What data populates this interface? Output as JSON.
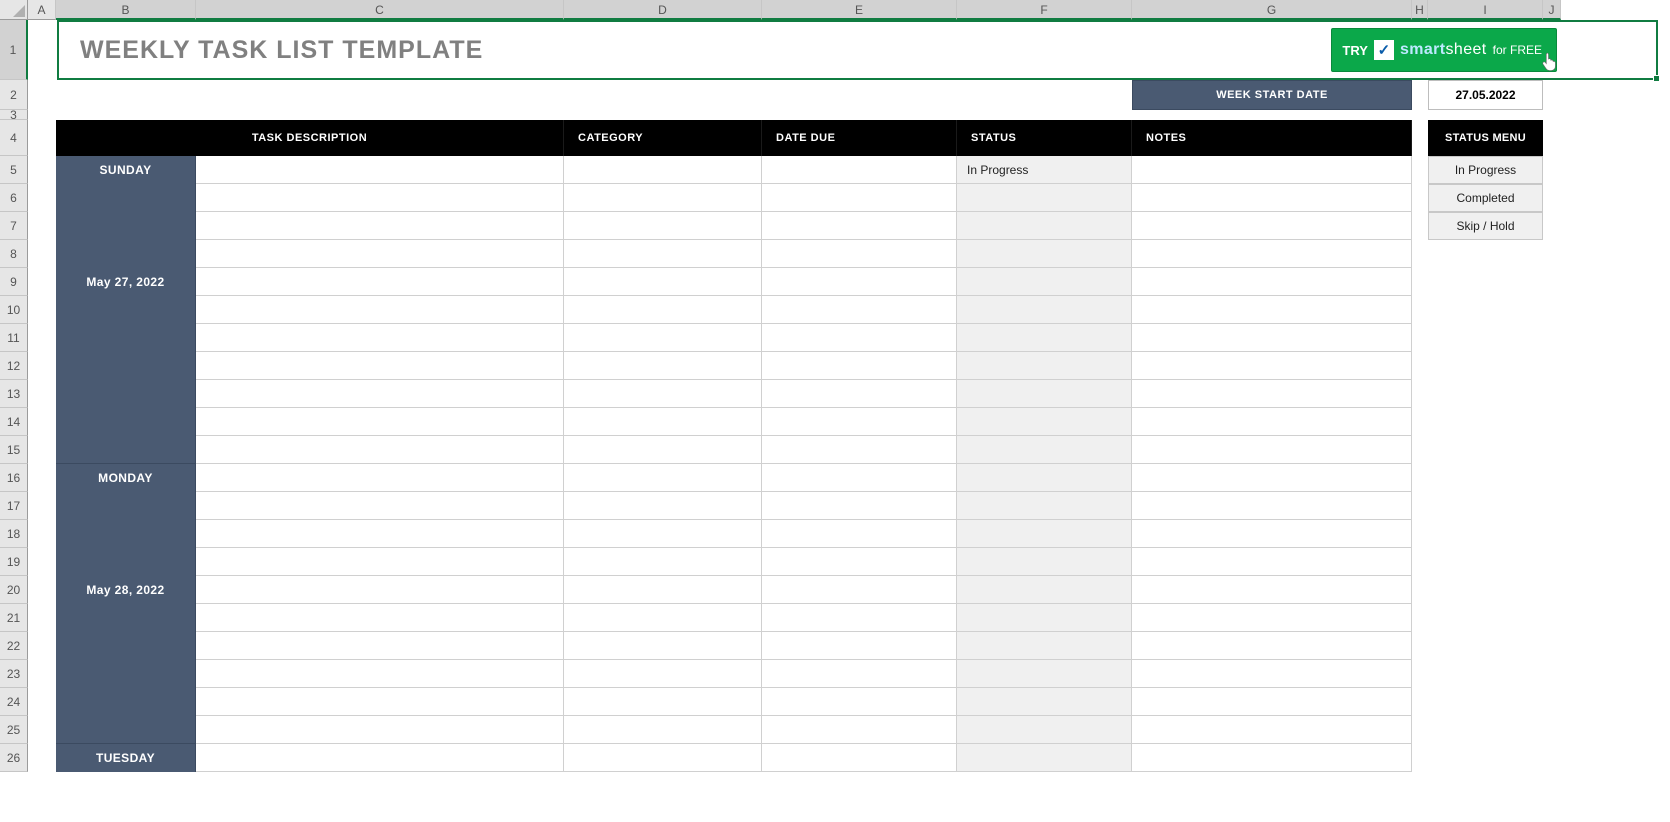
{
  "columns": [
    "",
    "A",
    "B",
    "C",
    "D",
    "E",
    "F",
    "G",
    "H",
    "I",
    "J"
  ],
  "rows": [
    "1",
    "2",
    "3",
    "4",
    "5",
    "6",
    "7",
    "8",
    "9",
    "10",
    "11",
    "12",
    "13",
    "14",
    "15",
    "16",
    "17",
    "18",
    "19",
    "20",
    "21",
    "22",
    "23",
    "24",
    "25",
    "26"
  ],
  "title": "WEEKLY TASK LIST TEMPLATE",
  "try_btn": {
    "try": "TRY",
    "brand1": "smart",
    "brand2": "sheet",
    "for_free": "for FREE"
  },
  "week_start_label": "WEEK START DATE",
  "week_start_date": "27.05.2022",
  "headers": {
    "task": "TASK DESCRIPTION",
    "category": "CATEGORY",
    "date_due": "DATE DUE",
    "status": "STATUS",
    "notes": "NOTES",
    "status_menu": "STATUS MENU"
  },
  "days": [
    {
      "name": "SUNDAY",
      "date": "May 27, 2022",
      "rows": 11,
      "cells": [
        {
          "r": 0,
          "status": "In Progress"
        }
      ]
    },
    {
      "name": "MONDAY",
      "date": "May 28, 2022",
      "rows": 10,
      "cells": []
    },
    {
      "name": "TUESDAY",
      "date": "",
      "rows": 1,
      "cells": []
    }
  ],
  "status_menu": [
    "In Progress",
    "Completed",
    "Skip / Hold"
  ]
}
